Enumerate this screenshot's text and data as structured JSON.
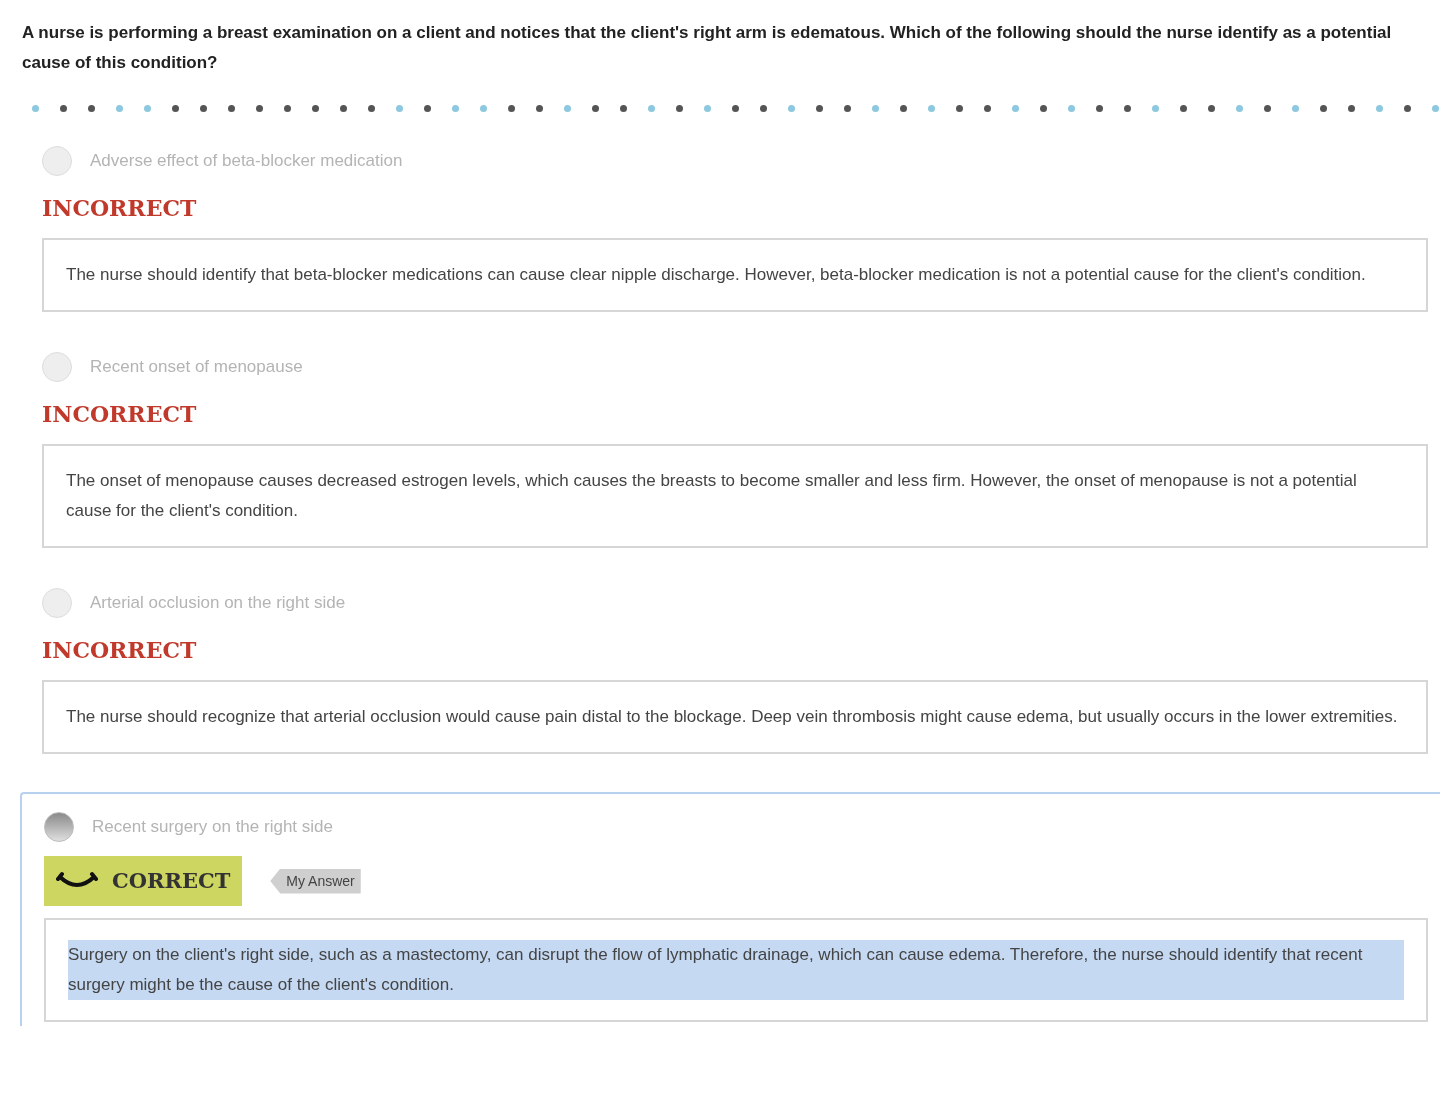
{
  "question": "A nurse is performing a breast examination on a client and notices that the client's right arm is edematous. Which of the following should the nurse identify as a potential cause of this condition?",
  "options": [
    {
      "label": "Adverse effect of beta-blocker medication",
      "selected": false,
      "result": {
        "kind": "incorrect",
        "label": "INCORRECT"
      },
      "explanation": "The nurse should identify that beta-blocker medications can cause clear nipple discharge. However, beta-blocker medication is not a potential cause for the client's condition.",
      "highlighted": false
    },
    {
      "label": "Recent onset of menopause",
      "selected": false,
      "result": {
        "kind": "incorrect",
        "label": "INCORRECT"
      },
      "explanation": "The onset of menopause causes decreased estrogen levels, which causes the breasts to become smaller and less firm. However, the onset of menopause is not a potential cause for the client's condition.",
      "highlighted": false
    },
    {
      "label": "Arterial occlusion on the right side",
      "selected": false,
      "result": {
        "kind": "incorrect",
        "label": "INCORRECT"
      },
      "explanation": "The nurse should recognize that arterial occlusion would cause pain distal to the blockage. Deep vein thrombosis might cause edema, but usually occurs in the lower extremities.",
      "highlighted": false
    },
    {
      "label": "Recent surgery on the right side",
      "selected": true,
      "result": {
        "kind": "correct",
        "label": "CORRECT"
      },
      "my_answer": "My Answer",
      "explanation": "Surgery on the client's right side, such as a mastectomy, can disrupt the flow of lymphatic drainage, which can cause edema. Therefore, the nurse should identify that recent surgery might be the cause of the client's condition.",
      "highlighted": true
    }
  ]
}
